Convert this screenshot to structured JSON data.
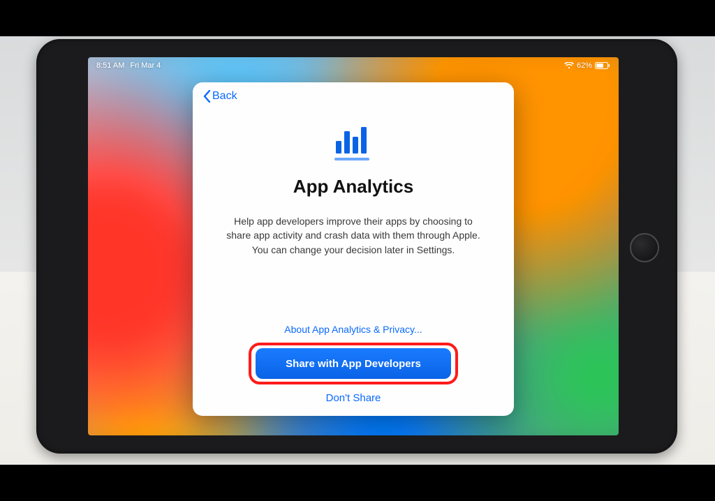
{
  "status_bar": {
    "time": "8:51 AM",
    "date": "Fri Mar 4",
    "battery_percent": "62%"
  },
  "modal": {
    "back_label": "Back",
    "title": "App Analytics",
    "description": "Help app developers improve their apps by choosing to share app activity and crash data with them through Apple. You can change your decision later in Settings.",
    "about_link": "About App Analytics & Privacy...",
    "primary_button": "Share with App Developers",
    "secondary_button": "Don't Share"
  },
  "annotation": {
    "highlight": "primary_button"
  }
}
